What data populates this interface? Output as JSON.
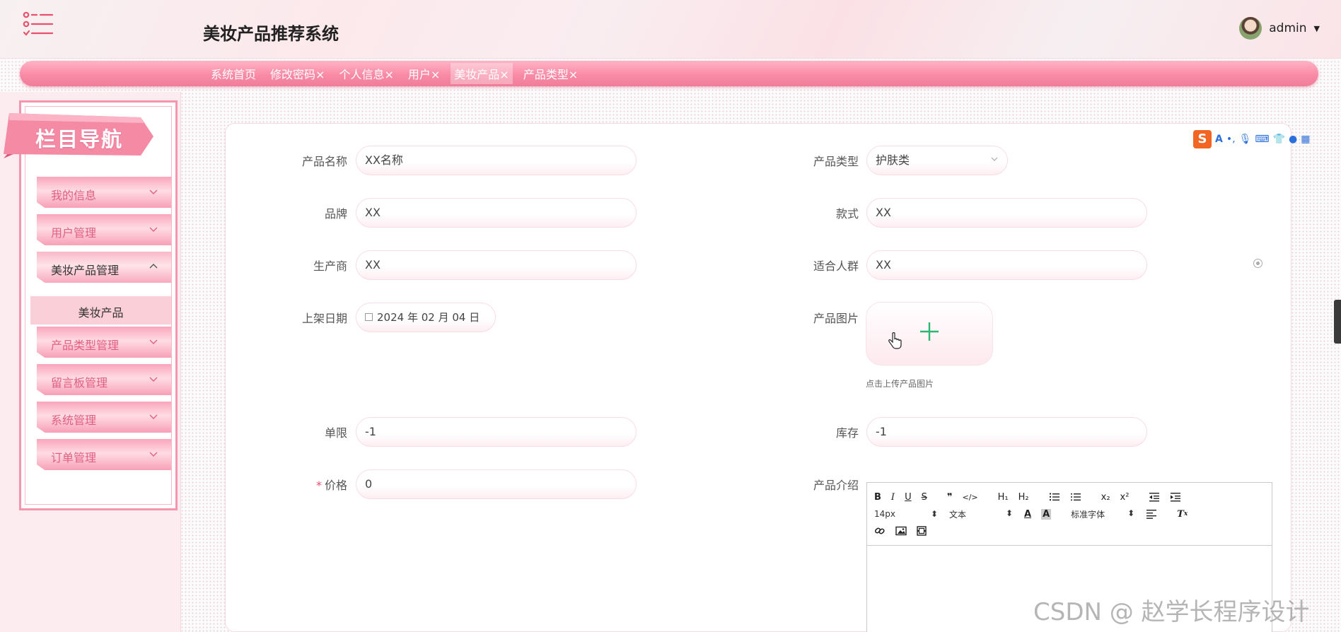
{
  "app": {
    "title": "美妆产品推荐系统"
  },
  "user": {
    "name": "admin"
  },
  "tabs": [
    {
      "label": "系统首页"
    },
    {
      "label": "修改密码×"
    },
    {
      "label": "个人信息×"
    },
    {
      "label": "用户×"
    },
    {
      "label": "美妆产品×"
    },
    {
      "label": "产品类型×"
    }
  ],
  "sidebar": {
    "banner": "栏目导航",
    "items": [
      {
        "label": "我的信息"
      },
      {
        "label": "用户管理"
      },
      {
        "label": "美妆产品管理"
      },
      {
        "label": "产品类型管理"
      },
      {
        "label": "留言板管理"
      },
      {
        "label": "系统管理"
      },
      {
        "label": "订单管理"
      }
    ],
    "submenu": "美妆产品"
  },
  "form": {
    "name": {
      "label": "产品名称",
      "value": "XX名称"
    },
    "category": {
      "label": "产品类型",
      "value": "护肤类"
    },
    "brand": {
      "label": "品牌",
      "value": "XX"
    },
    "style": {
      "label": "款式",
      "value": "XX"
    },
    "maker": {
      "label": "生产商",
      "value": "XX"
    },
    "audience": {
      "label": "适合人群",
      "value": "XX"
    },
    "date": {
      "label": "上架日期",
      "value": "2024 年 02 月 04 日"
    },
    "image": {
      "label": "产品图片",
      "hint": "点击上传产品图片"
    },
    "limit": {
      "label": "单限",
      "value": "-1"
    },
    "stock": {
      "label": "库存",
      "value": "-1"
    },
    "price": {
      "label": "价格",
      "required_mark": "*",
      "value": "0"
    },
    "intro": {
      "label": "产品介绍"
    }
  },
  "editor": {
    "buttons_row1": [
      "B",
      "I",
      "U",
      "S",
      "❞",
      "</>",
      "H1",
      "H2",
      "ol",
      "ul",
      "x₂",
      "x²",
      "outdent",
      "indent"
    ],
    "font_size": "14px",
    "paragraph": "文本",
    "font_family": "标准字体"
  },
  "watermark": "CSDN @ 赵学长程序设计",
  "colors": {
    "accent": "#f58aa5",
    "accent_dark": "#e0607f",
    "plus": "#2bb673"
  }
}
